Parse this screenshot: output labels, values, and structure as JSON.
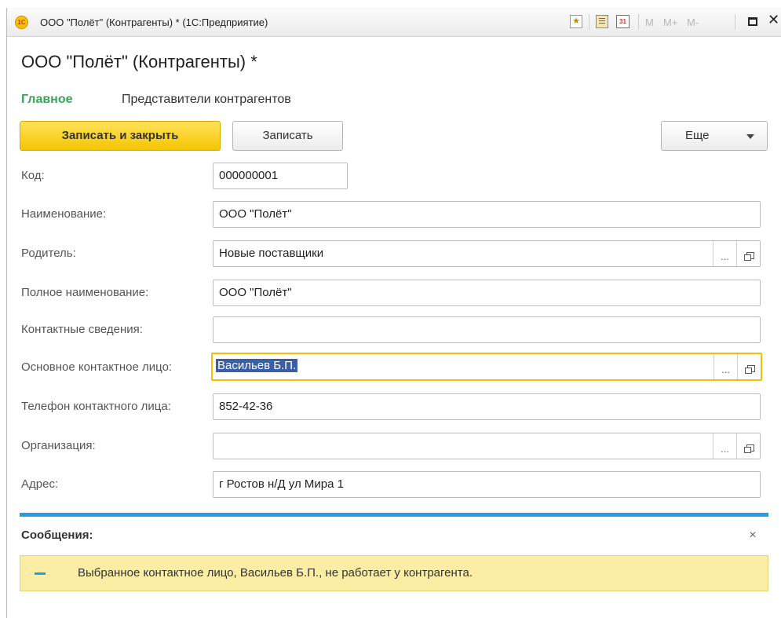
{
  "window": {
    "title": "ООО \"Полёт\" (Контрагенты) * (1С:Предприятие)",
    "logo_text": "1C",
    "calendar_day": "31",
    "mem_labels": [
      "M",
      "M+",
      "M-"
    ]
  },
  "form": {
    "title": "ООО \"Полёт\" (Контрагенты) *",
    "tabs": [
      "Главное",
      "Представители контрагентов"
    ],
    "buttons": {
      "save_close": "Записать и закрыть",
      "save": "Записать",
      "more": "Еще"
    },
    "fields": [
      {
        "label": "Код:",
        "value": "000000001"
      },
      {
        "label": "Наименование:",
        "value": "ООО \"Полёт\""
      },
      {
        "label": "Родитель:",
        "value": "Новые поставщики"
      },
      {
        "label": "Полное наименование:",
        "value": "ООО \"Полёт\""
      },
      {
        "label": "Контактные сведения:",
        "value": ""
      },
      {
        "label": "Основное контактное лицо:",
        "value": "Васильев Б.П."
      },
      {
        "label": "Телефон контактного лица:",
        "value": "852-42-36"
      },
      {
        "label": "Организация:",
        "value": ""
      },
      {
        "label": "Адрес:",
        "value": "г Ростов н/Д ул Мира 1"
      }
    ],
    "field_button_dots": "..."
  },
  "messages": {
    "title": "Сообщения:",
    "close": "×",
    "items": [
      {
        "text": "Выбранное контактное лицо, Васильев Б.П., не работает у контрагента."
      }
    ]
  },
  "colors": {
    "accent_green": "#3aa55a",
    "primary_yellow": "#f4c500",
    "message_blue": "#1da1e2",
    "message_bg": "#fbeda4",
    "selection": "#3a5fa8"
  }
}
